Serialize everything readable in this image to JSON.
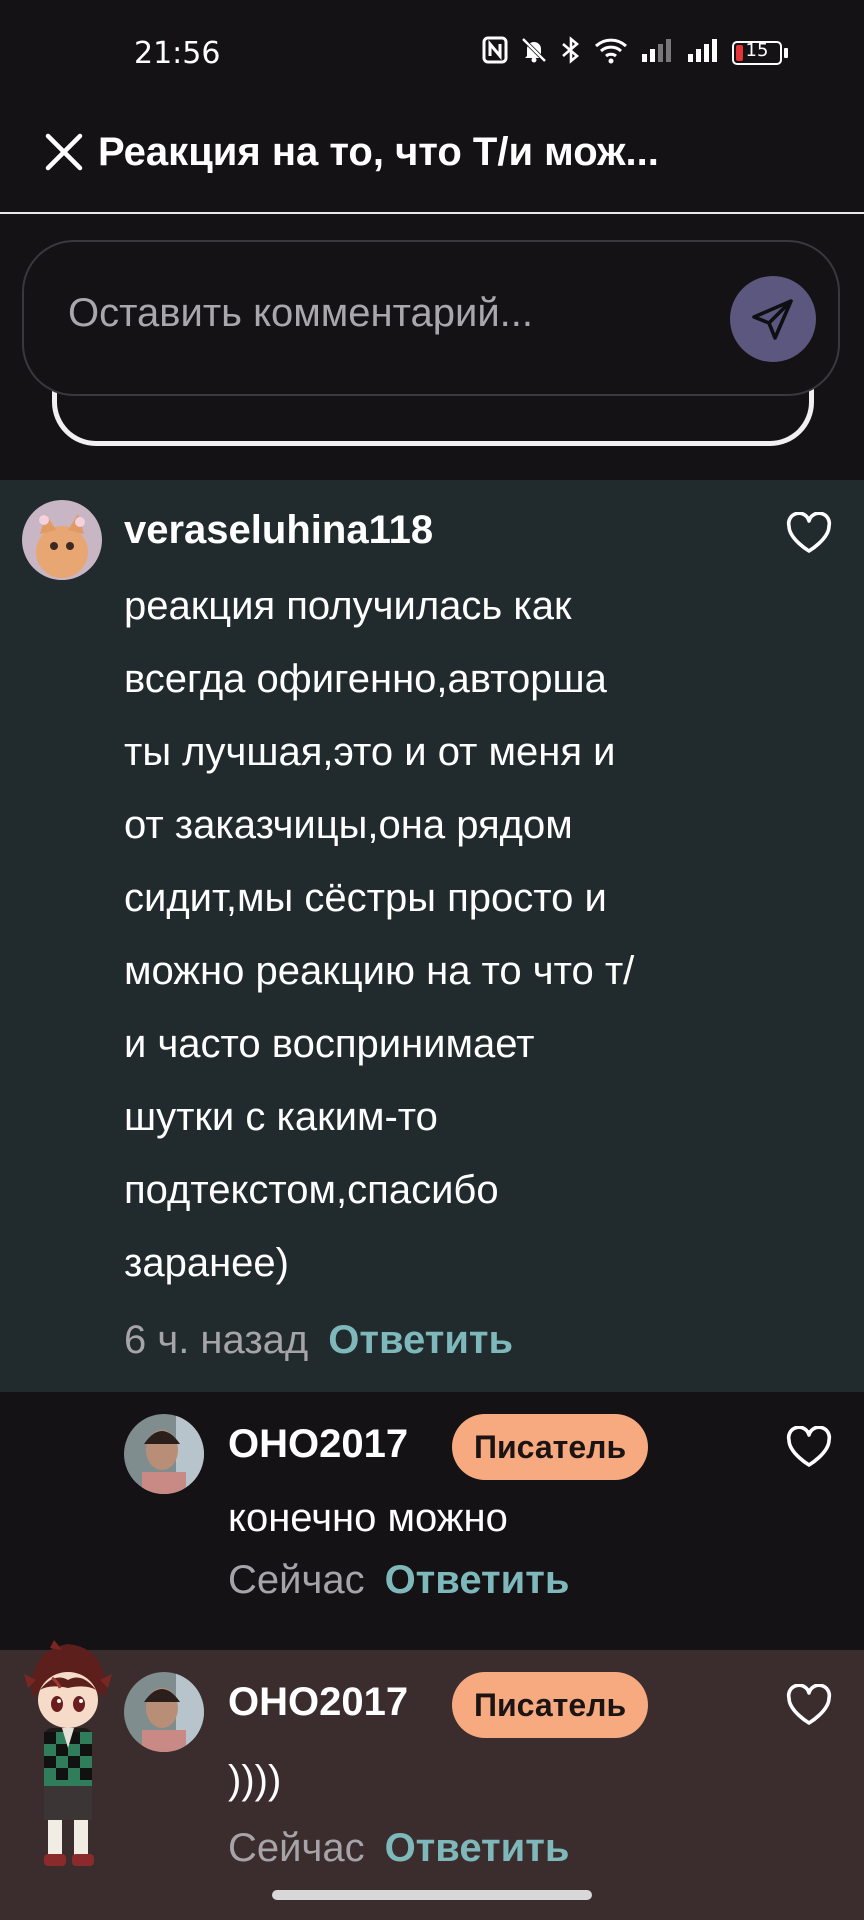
{
  "status_bar": {
    "time": "21:56",
    "icons": [
      "nfc-icon",
      "mute-icon",
      "bluetooth-icon",
      "wifi-icon",
      "signal-icon",
      "signal-icon",
      "battery-icon"
    ],
    "battery": "15",
    "battery_color": "#e2363a"
  },
  "header": {
    "title": "Реакция на то, что Т/и мож..."
  },
  "composer": {
    "placeholder": "Оставить комментарий..."
  },
  "colors": {
    "accent_reply": "#7fb8bb",
    "badge_bg": "#f7a97f",
    "send_button_bg": "#5b577e"
  },
  "comments": [
    {
      "username": "veraseluhina118",
      "text": "реакция получилась как\nвсегда офигенно,авторша\nты лучшая,это и от меня и\nот заказчицы,она рядом\nсидит,мы сёстры просто и\nможно реакцию на то что т/\nи часто воспринимает\nшутки с каким-то\nподтекстом,спасибо\nзаранее)",
      "time": "6 ч. назад",
      "reply_label": "Ответить"
    },
    {
      "username": "OHO2017",
      "badge": "Писатель",
      "text": "конечно можно",
      "time": "Сейчас",
      "reply_label": "Ответить"
    },
    {
      "username": "OHO2017",
      "badge": "Писатель",
      "text": "))))",
      "time": "Сейчас",
      "reply_label": "Ответить"
    }
  ]
}
